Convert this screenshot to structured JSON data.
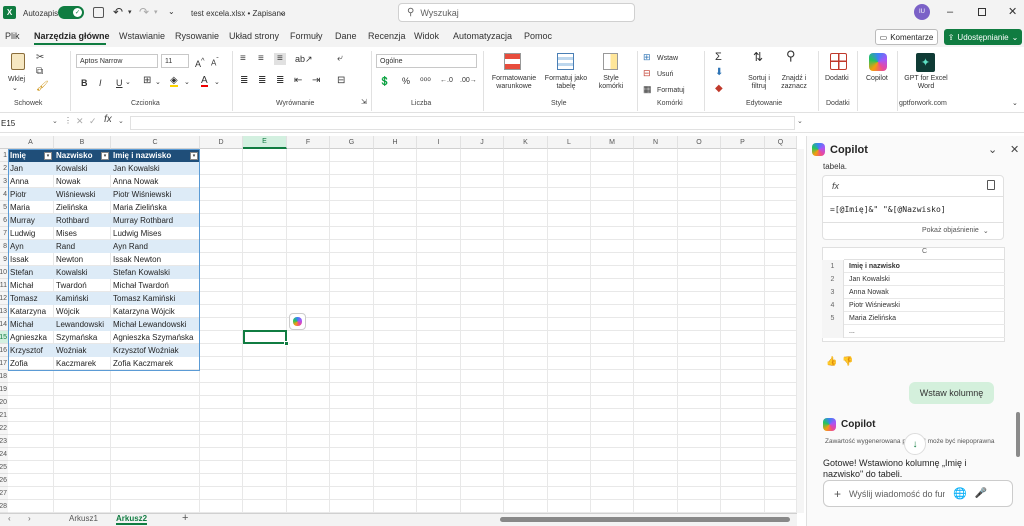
{
  "titlebar": {
    "autosave_label": "Autozapis",
    "toggle_state": "Wł.",
    "file_title": "test excela.xlsx • Zapisano",
    "search_placeholder": "Wyszukaj",
    "user_initials": "IU"
  },
  "tabs": [
    "Plik",
    "Narzędzia główne",
    "Wstawianie",
    "Rysowanie",
    "Układ strony",
    "Formuły",
    "Dane",
    "Recenzja",
    "Widok",
    "Automatyzacja",
    "Pomoc"
  ],
  "active_tab": "Narzędzia główne",
  "buttons": {
    "comments": "Komentarze",
    "share": "Udostępnianie"
  },
  "ribbon": {
    "paste_label": "Wklej",
    "font_name": "Aptos Narrow",
    "font_size": "11",
    "number_format": "Ogólne",
    "group_labels": [
      "Schowek",
      "Czcionka",
      "Wyrównanie",
      "Liczba",
      "Style",
      "Komórki",
      "Edytowanie",
      "Dodatki",
      "gptforwork.com"
    ],
    "cond_format": "Formatowanie warunkowe",
    "format_table": "Formatuj jako tabelę",
    "cell_styles": "Style komórki",
    "insert": "Wstaw",
    "delete": "Usuń",
    "format": "Formatuj",
    "sort_filter": "Sortuj i filtruj",
    "find_select": "Znajdź i zaznacz",
    "addins": "Dodatki",
    "copilot": "Copilot",
    "gpt": "GPT for Excel Word",
    "font_buttons": [
      "B",
      "I",
      "U"
    ]
  },
  "formula_bar": {
    "name_box": "E15",
    "fx": "fx",
    "content": ""
  },
  "columns": [
    "A",
    "B",
    "C",
    "D",
    "E",
    "F",
    "G",
    "H",
    "I",
    "J",
    "K",
    "L",
    "M",
    "N",
    "O",
    "P",
    "Q"
  ],
  "rows": [
    "1",
    "2",
    "3",
    "4",
    "5",
    "6",
    "7",
    "8",
    "9",
    "10",
    "11",
    "12",
    "13",
    "14",
    "15",
    "16",
    "17",
    "18",
    "19",
    "20",
    "21",
    "22",
    "23",
    "24",
    "25",
    "26",
    "27",
    "28"
  ],
  "table": {
    "headers": [
      "Imię",
      "Nazwisko",
      "Imię i nazwisko"
    ],
    "rows": [
      [
        "Jan",
        "Kowalski",
        "Jan Kowalski"
      ],
      [
        "Anna",
        "Nowak",
        "Anna Nowak"
      ],
      [
        "Piotr",
        "Wiśniewski",
        "Piotr Wiśniewski"
      ],
      [
        "Maria",
        "Zielińska",
        "Maria Zielińska"
      ],
      [
        "Murray",
        "Rothbard",
        "Murray Rothbard"
      ],
      [
        "Ludwig",
        "Mises",
        "Ludwig Mises"
      ],
      [
        "Ayn",
        "Rand",
        "Ayn Rand"
      ],
      [
        "Issak",
        "Newton",
        "Issak Newton"
      ],
      [
        "Stefan",
        "Kowalski",
        "Stefan Kowalski"
      ],
      [
        "Michał",
        "Twardoń",
        "Michał Twardoń"
      ],
      [
        "Tomasz",
        "Kamiński",
        "Tomasz Kamiński"
      ],
      [
        "Katarzyna",
        "Wójcik",
        "Katarzyna Wójcik"
      ],
      [
        "Michał",
        "Lewandowski",
        "Michał Lewandowski"
      ],
      [
        "Agnieszka",
        "Szymańska",
        "Agnieszka Szymańska"
      ],
      [
        "Krzysztof",
        "Woźniak",
        "Krzysztof Woźniak"
      ],
      [
        "Zofia",
        "Kaczmarek",
        "Zofia Kaczmarek"
      ]
    ]
  },
  "sheets": [
    "Arkusz1",
    "Arkusz2"
  ],
  "active_sheet": "Arkusz2",
  "copilot": {
    "title": "Copilot",
    "truncated_text": "tabela.",
    "formula_icon": "fx",
    "formula": "=[@Imię]&\" \"&[@Nazwisko]",
    "show_explanation": "Pokaż objaśnienie",
    "mini_col": "C",
    "mini_rows": [
      {
        "n": "1",
        "v": "Imię i nazwisko"
      },
      {
        "n": "2",
        "v": "Jan Kowalski"
      },
      {
        "n": "3",
        "v": "Anna Nowak"
      },
      {
        "n": "4",
        "v": "Piotr Wiśniewski"
      },
      {
        "n": "5",
        "v": "Maria Zielińska"
      },
      {
        "n": "",
        "v": "..."
      }
    ],
    "user_message": "Wstaw kolumnę",
    "bot_name": "Copilot",
    "disclaimer": "Zawartość wygenerowana przez AI może być niepoprawna",
    "reply": "Gotowe! Wstawiono kolumnę „Imię i nazwisko\" do tabeli.",
    "input_placeholder": "Wyślij wiadomość do funkcji Copilot"
  }
}
